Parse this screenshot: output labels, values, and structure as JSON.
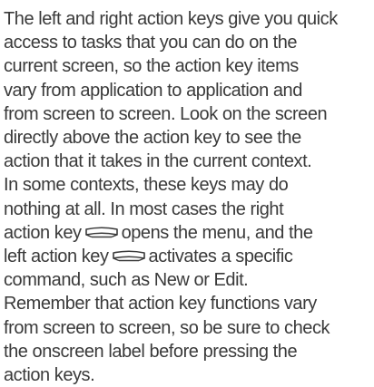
{
  "lines": [
    "The left and right action keys give you quick",
    "access to tasks that you can do on the",
    "current screen, so the action key items",
    "vary from application to application and",
    "from screen to screen. Look on the screen",
    "directly above the action key to see the",
    "action that it takes in the current context.",
    "In some contexts, these keys may do",
    "nothing at all. In most cases the right",
    {
      "before": "action key",
      "icon": "right-action-key-icon",
      "after": "opens the menu, and the"
    },
    {
      "before": "left action key",
      "icon": "left-action-key-icon",
      "after": "activates a specific"
    },
    "command, such as New or Edit.",
    "Remember that action key functions vary",
    "from screen to screen, so be sure to check",
    "the onscreen label before pressing the",
    "action keys."
  ]
}
